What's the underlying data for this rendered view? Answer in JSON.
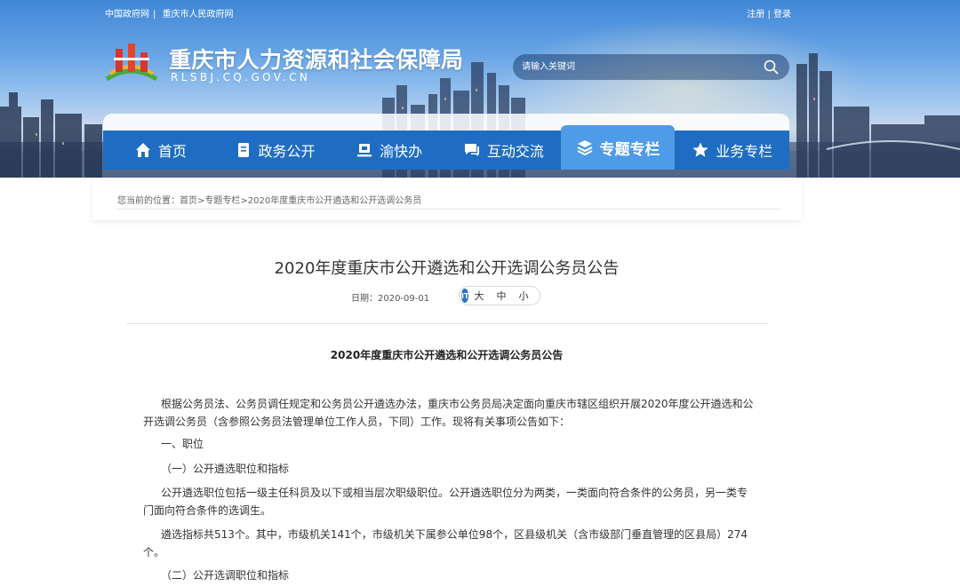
{
  "header": {
    "top_links": [
      "中国政府网",
      "重庆市人民政府网"
    ],
    "separator": "|",
    "account": {
      "register": "注册",
      "login": "登录"
    },
    "site_title": "重庆市人力资源和社会保障局",
    "site_domain": "RLSBJ.CQ.GOV.CN",
    "search": {
      "placeholder": "请输入关键词"
    }
  },
  "nav": {
    "items": [
      {
        "label": "首页",
        "icon": "home-icon"
      },
      {
        "label": "政务公开",
        "icon": "document-icon"
      },
      {
        "label": "渝快办",
        "icon": "service-icon"
      },
      {
        "label": "互动交流",
        "icon": "chat-icon"
      },
      {
        "label": "专题专栏",
        "icon": "layers-icon",
        "active": true
      },
      {
        "label": "业务专栏",
        "icon": "star-icon"
      }
    ]
  },
  "breadcrumb": {
    "prefix": "您当前的位置：",
    "items": [
      "首页",
      "专题专栏",
      "2020年度重庆市公开遴选和公开选调公务员"
    ],
    "separator": ">"
  },
  "article": {
    "title": "2020年度重庆市公开遴选和公开选调公务员公告",
    "date": "日期：2020-09-01",
    "font_size": {
      "icon_text": "IT",
      "large": "大",
      "medium": "中",
      "small": "小"
    },
    "heading": "2020年度重庆市公开遴选和公开选调公务员公告",
    "paragraphs": [
      "根据公务员法、公务员调任规定和公务员公开遴选办法，重庆市公务员局决定面向重庆市辖区组织开展2020年度公开遴选和公开选调公务员（含参照公务员法管理单位工作人员，下同）工作。现将有关事项公告如下：",
      "一、职位",
      "（一）公开遴选职位和指标",
      "公开遴选职位包括一级主任科员及以下或相当层次职级职位。公开遴选职位分为两类，一类面向符合条件的公务员，另一类专门面向符合条件的选调生。",
      "遴选指标共513个。其中，市级机关141个，市级机关下属参公单位98个，区县级机关（含市级部门垂直管理的区县局）274个。",
      "（二）公开选调职位和指标"
    ]
  },
  "colors": {
    "nav_blue": "#1f6dc2",
    "nav_active": "#4e9be8"
  }
}
